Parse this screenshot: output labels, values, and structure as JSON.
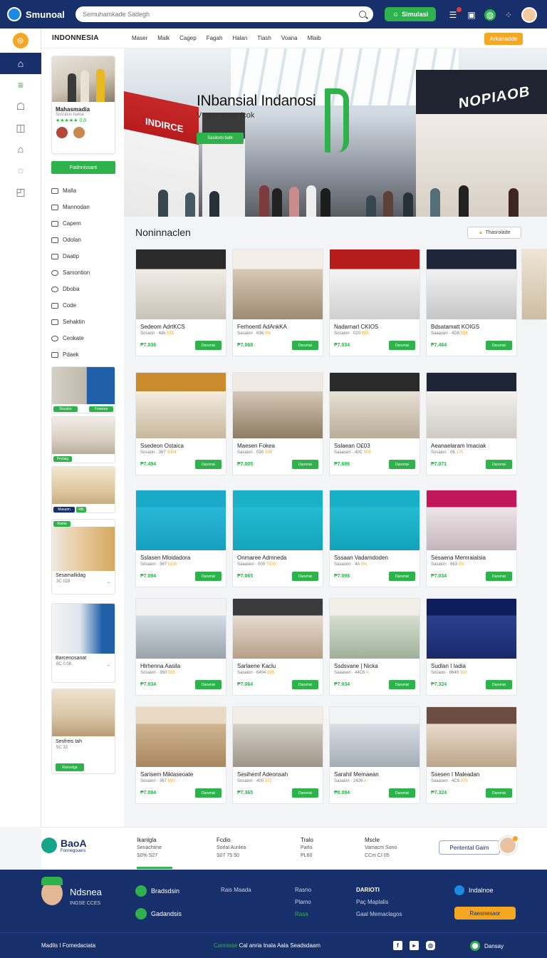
{
  "topbar": {
    "app_name": "Smunoal",
    "search_placeholder": "Semuhamkade Sadegh",
    "action_label": "Simulasi"
  },
  "nav": {
    "brand": "INDONNESIA",
    "links": [
      "Maser",
      "Malk",
      "Cagep",
      "Fagah",
      "Halan",
      "Tlash",
      "Voana",
      "Mlaib"
    ],
    "cta": "Arkanadde"
  },
  "sidebar": {
    "profile_name": "Mahasmadia",
    "profile_sub": "Sosrasis hatoa",
    "profile_rating": "0.8",
    "button": "Fadnnissant",
    "menu": [
      "Malla",
      "Mannodan",
      "Capem",
      "Odolan",
      "Daatip",
      "Samontion",
      "Dboba",
      "Code",
      "Sehaktin",
      "Ceokate",
      "Pdaek"
    ],
    "thumbs": [
      {
        "tags": [
          "Rouskn",
          "Frasesa"
        ]
      },
      {
        "tags": [
          "Pexlaig"
        ]
      },
      {
        "tags": [
          "Masaim",
          "Rtk"
        ]
      },
      {
        "tags": [
          "Ranta"
        ],
        "title": "Sesamallidag",
        "meta": "3C 028"
      },
      {
        "title": "Barcenosanat",
        "meta": "8C 0.08"
      },
      {
        "title": "Sesfreis tah",
        "meta": "5C 33",
        "tags": [
          "Rancelga"
        ]
      }
    ]
  },
  "hero": {
    "title": "INbansial Indanosi",
    "subtitle": "Vnoncnems /cok",
    "button": "Sasilomi batk",
    "sign_left": "INDIRCE",
    "sign_right": "NOPIAOB"
  },
  "section": {
    "title": "Noninnaclen",
    "action": "Thasrolade"
  },
  "cards": [
    {
      "title": "Sedeom AdrtKCS",
      "meta": "Sosaon · 4dk",
      "rating": "535",
      "price": "₱7.036",
      "button": "Darsmat"
    },
    {
      "title": "Ferhoentl AdAnkKA",
      "meta": "Sasaion · 636",
      "rating": "0%",
      "price": "₱7.068",
      "button": "Darsmat"
    },
    {
      "title": "Nadarnarl CKIOS",
      "meta": "Sosaion · 020",
      "rating": "555",
      "price": "₱7.034",
      "button": "Darsmat"
    },
    {
      "title": "Bdsatamatt KOIGS",
      "meta": "Saaasen · 4D8",
      "rating": "556",
      "price": "₱7.464",
      "button": "Darsmat"
    },
    {
      "title": "Ssedeon Ostaica",
      "meta": "Sosaon · 367",
      "rating": "3004",
      "price": "₱7.494",
      "button": "Darsmat"
    },
    {
      "title": "Maesen Fokea",
      "meta": "Sasaion · 030",
      "rating": "S08",
      "price": "₱7.005",
      "button": "Darsmat"
    },
    {
      "title": "Sslaean O£03",
      "meta": "Saaasen · 40C",
      "rating": "008",
      "price": "₱7.696",
      "button": "Darsmat"
    },
    {
      "title": "Aeanaelaram Imaciak",
      "meta": "Sosaion · 06",
      "rating": "170",
      "price": "₱7.071",
      "button": "Darsmat"
    },
    {
      "title": "Sslasen Mloidadora",
      "meta": "Sosaion · 367",
      "rating": "CO6",
      "price": "₱7.094",
      "button": "Darsmat"
    },
    {
      "title": "Onmaree Admneda",
      "meta": "Saaasen · 000",
      "rating": "7000",
      "price": "₱7.065",
      "button": "Darsmat"
    },
    {
      "title": "Sssaan Vadamdoden",
      "meta": "Sasaoon · 4A",
      "rating": "0%",
      "price": "₱7.098",
      "button": "Darsmat"
    },
    {
      "title": "Sesaena Memraialsia",
      "meta": "Sasaion · 663",
      "rating": "0%",
      "price": "₱7.034",
      "button": "Darsmat"
    },
    {
      "title": "Hlrhenna Aasila",
      "meta": "Sosaion · 360",
      "rating": "035",
      "price": "₱7.034",
      "button": "Darsmat"
    },
    {
      "title": "Sarlaene Kaclu",
      "meta": "Sasaion · 6404",
      "rating": "835",
      "price": "₱7.064",
      "button": "Darsmat"
    },
    {
      "title": "Ssdsvane | Nicka",
      "meta": "Saaasen · 44C6",
      "rating": "A",
      "price": "₱7.034",
      "button": "Darsmat"
    },
    {
      "title": "Sudlan I Iadia",
      "meta": "Sosaon · 8640",
      "rating": "100",
      "price": "₱7.324",
      "button": "Darsmat"
    },
    {
      "title": "Sarisem Miklaseoate",
      "meta": "Sosaion · 367",
      "rating": "590",
      "price": "₱7.094",
      "button": "Darsmat"
    },
    {
      "title": "Sesihemf Adeonsah",
      "meta": "Sosaion · 400",
      "rating": "370",
      "price": "₱7.365",
      "button": "Darsmat"
    },
    {
      "title": "Sarahil Memaean",
      "meta": "Sasaion · 2426",
      "rating": "A",
      "price": "₱0.094",
      "button": "Darsmat"
    },
    {
      "title": "Ssesen I Maleadan",
      "meta": "Saaasen · 4C6",
      "rating": "370",
      "price": "₱7.324",
      "button": "Darsmat"
    }
  ],
  "midfooter": {
    "brand": "BaoA",
    "tagline": "Fonnegouers",
    "cols": [
      {
        "head": "Ikanlgla",
        "line1": "Senachtine",
        "line2": "S0% S27"
      },
      {
        "head": "Fcdio",
        "line1": "Sorlal Aunlea",
        "line2": "S07 75 50"
      },
      {
        "head": "Tralo",
        "line1": "Parlo",
        "line2": "PL60"
      },
      {
        "head": "Mscle",
        "line1": "Vamacm Sono",
        "line2": "CCm CI 05"
      }
    ],
    "button": "Pentental Gaim"
  },
  "footer": {
    "name": "Ndsnea",
    "sub": "INGSE CCES",
    "pill1": "Bradsdsin",
    "pill2": "Gadandsis",
    "col1": [
      "Rais Maada"
    ],
    "col2": [
      "Rasno",
      "Plamo",
      "Rasa"
    ],
    "col3_head": "DARIOTI",
    "col3": [
      "Paç Maplalis",
      "Gaal Memaclagos"
    ],
    "right_label": "Indalnoe",
    "right_button": "Raesnesaor",
    "copyright": "Madlis I Fomedaciata",
    "mid_green": "Cannisse",
    "mid_white": "Cal anria tnala Aala Seadsdaam",
    "lang": "Dansay"
  }
}
